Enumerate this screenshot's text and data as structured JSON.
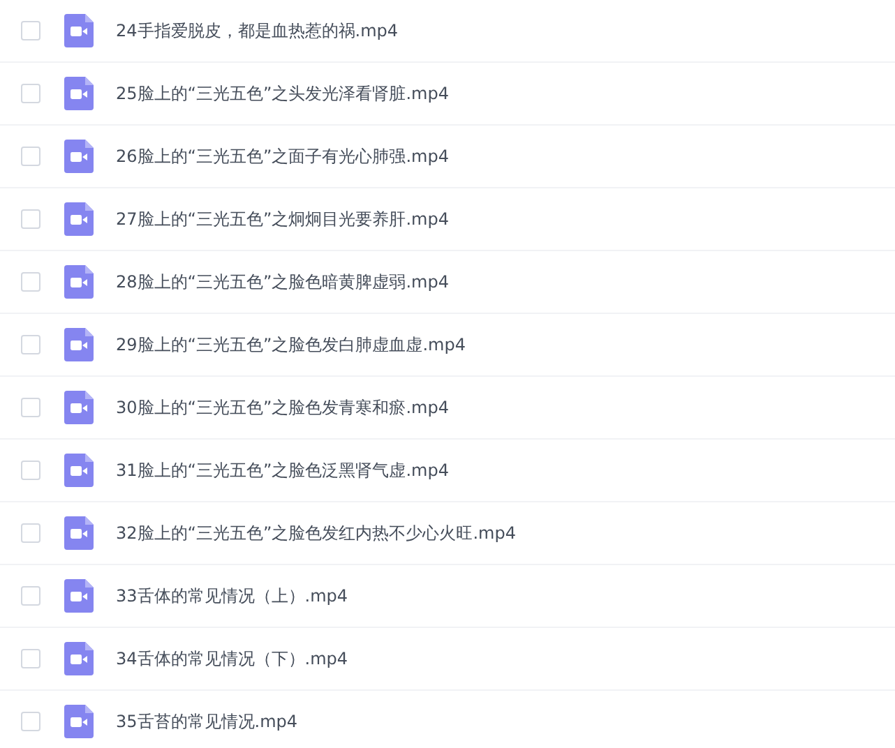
{
  "files": [
    {
      "name": "24手指爱脱皮，都是血热惹的祸.mp4",
      "checked": false
    },
    {
      "name": "25脸上的“三光五色”之头发光泽看肾脏.mp4",
      "checked": false
    },
    {
      "name": "26脸上的“三光五色”之面子有光心肺强.mp4",
      "checked": false
    },
    {
      "name": "27脸上的“三光五色”之炯炯目光要养肝.mp4",
      "checked": false
    },
    {
      "name": "28脸上的“三光五色”之脸色暗黄脾虚弱.mp4",
      "checked": false
    },
    {
      "name": "29脸上的“三光五色”之脸色发白肺虚血虚.mp4",
      "checked": false
    },
    {
      "name": "30脸上的“三光五色”之脸色发青寒和瘀.mp4",
      "checked": false
    },
    {
      "name": "31脸上的“三光五色”之脸色泛黑肾气虚.mp4",
      "checked": false
    },
    {
      "name": "32脸上的“三光五色”之脸色发红内热不少心火旺.mp4",
      "checked": false
    },
    {
      "name": "33舌体的常见情况（上）.mp4",
      "checked": false
    },
    {
      "name": "34舌体的常见情况（下）.mp4",
      "checked": false
    },
    {
      "name": "35舌苔的常见情况.mp4",
      "checked": false
    }
  ]
}
